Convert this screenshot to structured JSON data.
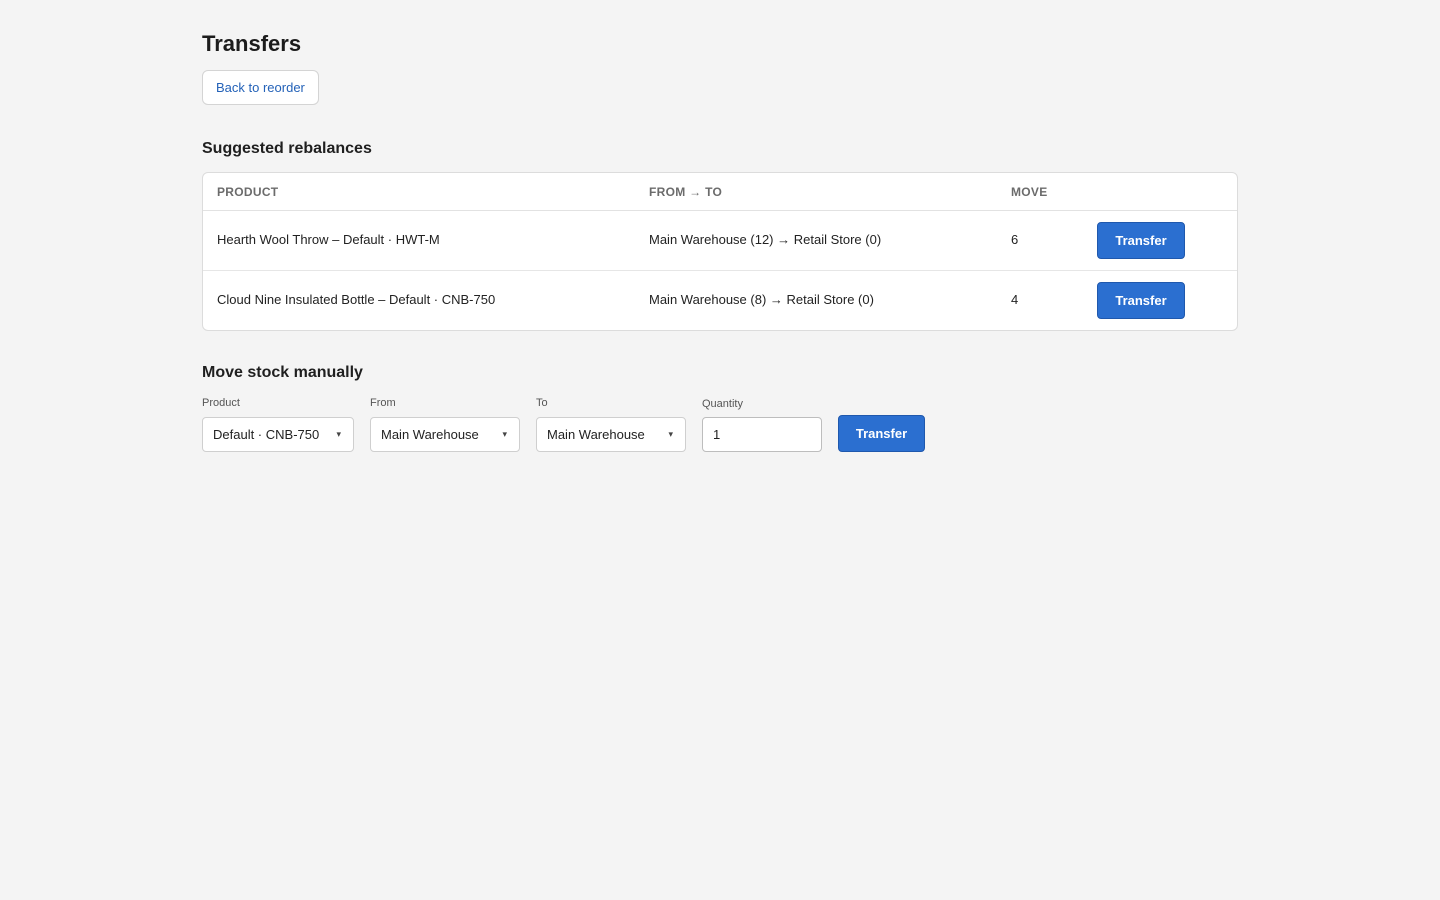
{
  "header": {
    "title": "Transfers",
    "back_label": "Back to reorder"
  },
  "rebalances": {
    "title": "Suggested rebalances",
    "columns": {
      "product": "PRODUCT",
      "from_to": "FROM → TO",
      "move": "MOVE"
    },
    "rows": [
      {
        "product": "Hearth Wool Throw – Default · HWT-M",
        "from_to": "Main Warehouse (12) → Retail Store (0)",
        "move": "6",
        "action": "Transfer"
      },
      {
        "product": "Cloud Nine Insulated Bottle – Default · CNB-750",
        "from_to": "Main Warehouse (8) → Retail Store (0)",
        "move": "4",
        "action": "Transfer"
      }
    ]
  },
  "manual": {
    "title": "Move stock manually",
    "product_label": "Product",
    "product_value": "Default · CNB-750",
    "from_label": "From",
    "from_value": "Main Warehouse",
    "to_label": "To",
    "to_value": "Main Warehouse",
    "quantity_label": "Quantity",
    "quantity_value": "1",
    "submit_label": "Transfer"
  },
  "icons": {
    "select_caret": "chevron-down-icon"
  },
  "colors": {
    "accent": "#2b6fd0",
    "link": "#2462b8",
    "background": "#f4f4f4"
  }
}
